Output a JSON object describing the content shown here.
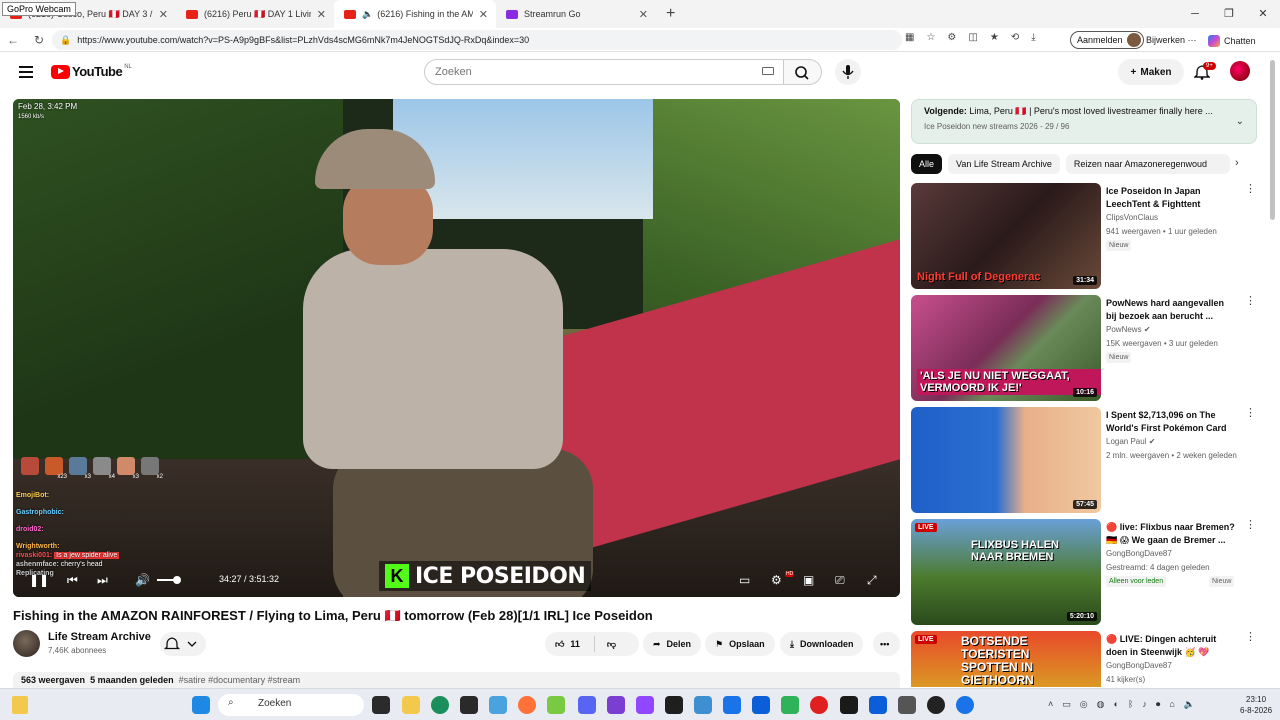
{
  "browser": {
    "webcam_label": "GoPro Webcam",
    "tabs": [
      {
        "title": "(6216) Cusco, Peru 🇵🇪 DAY 3 / Sac",
        "icon": "youtube-icon",
        "color": "#e62117"
      },
      {
        "title": "(6216) Peru 🇵🇪 DAY 1 Living in AM",
        "icon": "youtube-icon",
        "color": "#e62117"
      },
      {
        "title": "(6216) Fishing in the AMAZON",
        "icon": "youtube-icon",
        "color": "#e62117"
      },
      {
        "title": "Streamrun Go",
        "icon": "streamrun-icon",
        "color": "#8a2be2"
      }
    ],
    "url": "https://www.youtube.com/watch?v=PS-A9p9gBFs&list=PLzhVds4scMG6mNk7m4JeNOGTSdJQ-RxDq&index=30",
    "signin": "Aanmelden",
    "edit": "Bijwerken",
    "chat": "Chatten"
  },
  "youtube": {
    "logo_text": "YouTube",
    "region": "NL",
    "search_placeholder": "Zoeken",
    "create_label": "Maken",
    "notif_count": "9+"
  },
  "player": {
    "osd_date": "Feb 28, 3:42 PM",
    "osd_kbps": "1560 kb/s",
    "brand": "ICE POSEIDON",
    "time": "34:27 / 3:51:32",
    "emote_counts": [
      "x23",
      "x3",
      "x4",
      "x3",
      "x2"
    ],
    "chat": [
      {
        "user": "EmojiBot:",
        "color": "#ffd24d",
        "text": ""
      },
      {
        "user": "Gastrophobic:",
        "color": "#66ccff",
        "text": ""
      },
      {
        "user": "droid02:",
        "color": "#ff66cc",
        "text": ""
      },
      {
        "user": "Wrightworth:",
        "color": "#ffb84d",
        "text": ""
      },
      {
        "user": "rivaski001:",
        "color": "#ff4d4d",
        "text": "Is a jew spider alive"
      },
      {
        "user": "ashenmface:",
        "color": "#cccccc",
        "text": "cherry's head"
      },
      {
        "user": "Replicating",
        "color": "#cccccc",
        "text": ""
      }
    ]
  },
  "video": {
    "title": "Fishing in the AMAZON RAINFOREST / Flying to Lima, Peru 🇵🇪 tomorrow (Feb 28)[1/1 IRL] Ice Poseidon",
    "channel": "Life Stream Archive",
    "subscribers": "7,46K abonnees",
    "likes": "11",
    "share": "Delen",
    "save": "Opslaan",
    "download": "Downloaden",
    "views": "563 weergaven",
    "age": "5 maanden geleden",
    "tags": "#satire #documentary #stream"
  },
  "upnext": {
    "label": "Volgende:",
    "title": "Lima, Peru 🇵🇪 | Peru's most loved livestreamer finally here ...",
    "sub": "Ice Poseidon new streams 2026 - 29 / 96"
  },
  "chips": [
    "Alle",
    "Van Life Stream Archive",
    "Reizen naar Amazoneregenwoud"
  ],
  "recommendations": [
    {
      "title": "Ice Poseidon In Japan LeechTent & Fighttent",
      "channel": "ClipsVonClaus",
      "meta": "941 weergaven • 1 uur geleden",
      "badge": "Nieuw",
      "duration": "31:34",
      "caption": "Night Full of Degenerac",
      "thumb_color": "#3a2a2a",
      "verified": false,
      "live": false
    },
    {
      "title": "PowNews hard aangevallen bij bezoek aan berucht ...",
      "channel": "PowNews",
      "meta": "15K weergaven • 3 uur geleden",
      "badge": "Nieuw",
      "duration": "10:16",
      "caption": "'ALS JE NU NIET WEGGAAT, VERMOORD IK JE!'",
      "thumb_color": "#b63d78",
      "verified": true,
      "live": false
    },
    {
      "title": "I Spent $2,713,096 on The World's First Pokémon Card",
      "channel": "Logan Paul",
      "meta": "2 mln. weergaven • 2 weken geleden",
      "badge": "",
      "duration": "57:45",
      "caption": "",
      "thumb_color": "#2a6fd1",
      "verified": true,
      "live": false
    },
    {
      "title": "🔴 live: Flixbus naar Bremen?🇩🇪 😱 We gaan de Bremer ...",
      "channel": "GongBongDave87",
      "meta": "Gestreamd: 4 dagen geleden",
      "badge": "Alleen voor leden",
      "badge2": "Nieuw",
      "duration": "5:20:10",
      "caption": "FLIXBUS HALEN NAAR BREMEN",
      "thumb_color": "#4c7a2e",
      "verified": false,
      "live": true
    },
    {
      "title": "🔴 LIVE: Dingen achteruit doen in Steenwijk 🥳 💖",
      "channel": "GongBongDave87",
      "meta": "41 kijker(s)",
      "badge": "",
      "duration": "",
      "caption": "BOTSENDE TOERISTEN SPOTTEN IN GIETHOORN",
      "thumb_color": "#d9a323",
      "verified": false,
      "live": true
    }
  ],
  "taskbar": {
    "search_label": "Zoeken",
    "time": "23:10",
    "date": "6-8-2026",
    "app_colors": [
      "#1e88e5",
      "#2b2b2b",
      "#f2c94c",
      "#1b8f5b",
      "#2a2a2a",
      "#4aa3df",
      "#ff7139",
      "#7ac943",
      "#5865f2",
      "#7a3fd1",
      "#1f1f1f",
      "#3d8fd1",
      "#1a73e8",
      "#2fb35a",
      "#e91e63",
      "#e02020",
      "#1a1a1a",
      "#0b5ed7",
      "#444",
      "#333",
      "#1a73e8"
    ]
  }
}
